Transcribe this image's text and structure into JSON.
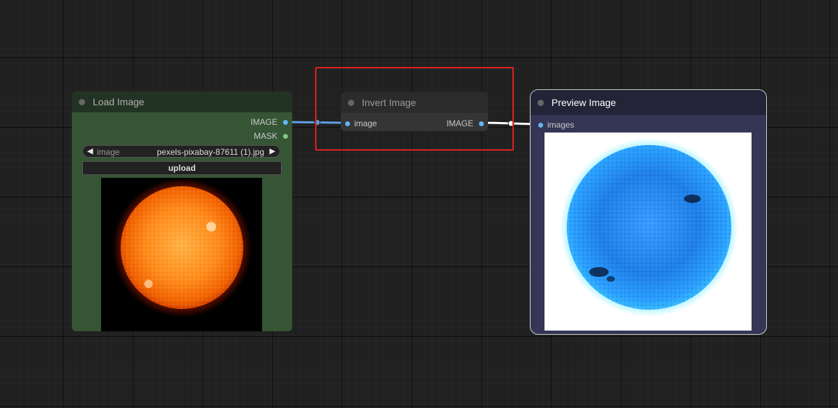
{
  "nodes": {
    "load_image": {
      "title": "Load Image",
      "outputs": [
        "IMAGE",
        "MASK"
      ],
      "widget_image_label": "image",
      "widget_image_value": "pexels-pixabay-87611 (1).jpg",
      "upload_label": "upload"
    },
    "invert_image": {
      "title": "Invert Image",
      "input": "image",
      "output": "IMAGE"
    },
    "preview_image": {
      "title": "Preview Image",
      "input": "images"
    }
  },
  "icons": {
    "combo_left": "triangle-left-icon",
    "combo_right": "triangle-right-icon",
    "title_dot": "circle-dot-icon"
  },
  "colors": {
    "image_slot": "#64b5f6",
    "mask_slot": "#81c784",
    "selection": "#e0221f"
  }
}
